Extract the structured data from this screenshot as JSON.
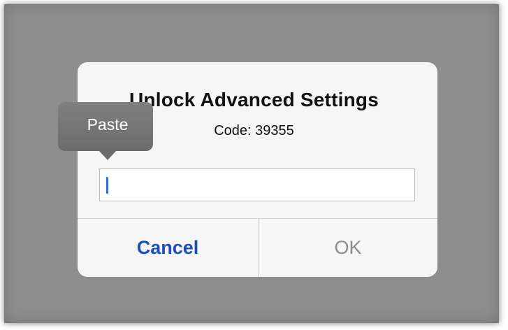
{
  "alert": {
    "title": "Unlock Advanced Settings",
    "message": "Code: 39355",
    "input_value": "",
    "cancel_label": "Cancel",
    "ok_label": "OK"
  },
  "context_menu": {
    "paste_label": "Paste"
  },
  "colors": {
    "dim_background": "#8e8e8f",
    "dialog_background": "#f6f6f6",
    "cancel_text": "#1a4fba",
    "ok_text_disabled": "#8c8c8c",
    "caret": "#2f6fe0",
    "popup_background": "#767676"
  }
}
